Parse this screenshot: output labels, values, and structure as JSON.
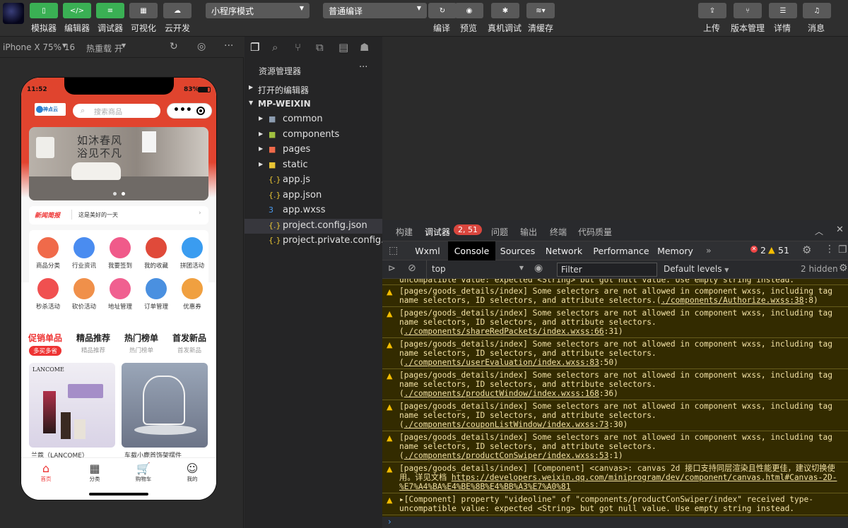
{
  "toolbar": {
    "simulator": "模拟器",
    "editor": "编辑器",
    "debugger": "调试器",
    "visual": "可视化",
    "cloud": "云开发",
    "mode_select": "小程序模式",
    "compile_select": "普通编译",
    "compile": "编译",
    "preview": "预览",
    "remote_debug": "真机调试",
    "clear_cache": "清缓存",
    "upload": "上传",
    "version": "版本管理",
    "details": "详情",
    "messages": "消息"
  },
  "sim_bar": {
    "device": "iPhone X 75% 16",
    "hot_reload": "热重载 开"
  },
  "phone": {
    "time": "11:52",
    "battery": "83%",
    "logo": "神点云",
    "search_placeholder": "搜索商品",
    "banner_line1": "如沐春风",
    "banner_line2": "浴见不凡",
    "news_tag": "新闻简报",
    "news_text": "这是美好的一天",
    "grid": [
      {
        "label": "商品分类",
        "color": "#f06a4a"
      },
      {
        "label": "行业资讯",
        "color": "#4a8cf0"
      },
      {
        "label": "我要签到",
        "color": "#f05a8a"
      },
      {
        "label": "我的收藏",
        "color": "#e04a3a"
      },
      {
        "label": "拼团活动",
        "color": "#3a9cf0"
      },
      {
        "label": "秒杀活动",
        "color": "#f05050"
      },
      {
        "label": "砍价活动",
        "color": "#f0904a"
      },
      {
        "label": "地址管理",
        "color": "#f06090"
      },
      {
        "label": "订单管理",
        "color": "#4a90e0"
      },
      {
        "label": "优惠券",
        "color": "#f0a040"
      }
    ],
    "tabs": [
      {
        "title": "促销单品",
        "sub": "多买多省"
      },
      {
        "title": "精品推荐",
        "sub": "精品推荐"
      },
      {
        "title": "热门榜单",
        "sub": "热门榜单"
      },
      {
        "title": "首发新品",
        "sub": "首发新品"
      }
    ],
    "prod1_brand": "LANCOME",
    "prod1_caption": "兰蔻（LANCOME）",
    "prod2_caption": "车载小鹿首饰架摆件",
    "nav": [
      {
        "label": "首页"
      },
      {
        "label": "分类"
      },
      {
        "label": "购物车"
      },
      {
        "label": "我的"
      }
    ]
  },
  "explorer": {
    "title": "资源管理器",
    "more": "···",
    "open_editors": "打开的编辑器",
    "project": "MP-WEIXIN",
    "items": [
      {
        "name": "common",
        "icon": "folder-icon"
      },
      {
        "name": "components",
        "icon": "folder-icon"
      },
      {
        "name": "pages",
        "icon": "folder-icon"
      },
      {
        "name": "static",
        "icon": "folder-icon"
      },
      {
        "name": "app.js",
        "icon": "js-file-icon"
      },
      {
        "name": "app.json",
        "icon": "json-file-icon"
      },
      {
        "name": "app.wxss",
        "icon": "css-file-icon"
      },
      {
        "name": "project.config.json",
        "icon": "json-file-icon"
      },
      {
        "name": "project.private.config...",
        "icon": "json-file-icon"
      }
    ]
  },
  "devtools": {
    "tabs": [
      "构建",
      "调试器",
      "问题",
      "输出",
      "终端",
      "代码质量"
    ],
    "badge": "2, 51",
    "panels": [
      "Wxml",
      "Console",
      "Sources",
      "Network",
      "Performance",
      "Memory"
    ],
    "more_panels": "»",
    "errors": "2",
    "warnings": "51",
    "context": "top",
    "filter_placeholder": "Filter",
    "levels": "Default levels",
    "hidden": "2 hidden",
    "prompt": "›",
    "messages": [
      {
        "text": "[pages/goods_details/index] Some selectors are not allowed in component wxss, including tag name selectors, ID selectors, and attribute selectors.(",
        "link": "./components/Authorize.wxss:38",
        "tail": ":8)"
      },
      {
        "text": "[pages/goods_details/index] Some selectors are not allowed in component wxss, including tag name selectors, ID selectors, and attribute selectors.(",
        "link": "./components/shareRedPackets/index.wxss:66",
        "tail": ":31)"
      },
      {
        "text": "[pages/goods_details/index] Some selectors are not allowed in component wxss, including tag name selectors, ID selectors, and attribute selectors.(",
        "link": "./components/userEvaluation/index.wxss:83",
        "tail": ":50)"
      },
      {
        "text": "[pages/goods_details/index] Some selectors are not allowed in component wxss, including tag name selectors, ID selectors, and attribute selectors.(",
        "link": "./components/productWindow/index.wxss:168",
        "tail": ":36)"
      },
      {
        "text": "[pages/goods_details/index] Some selectors are not allowed in component wxss, including tag name selectors, ID selectors, and attribute selectors.(",
        "link": "./components/couponListWindow/index.wxss:73",
        "tail": ":30)"
      },
      {
        "text": "[pages/goods_details/index] Some selectors are not allowed in component wxss, including tag name selectors, ID selectors, and attribute selectors.(",
        "link": "./components/productConSwiper/index.wxss:53",
        "tail": ":1)"
      },
      {
        "text": "[pages/goods_details/index] [Component] <canvas>: canvas 2d 接口支持同层渲染且性能更佳，建议切换使用。详见文档 ",
        "link": "https://developers.weixin.qq.com/miniprogram/dev/component/canvas.html#Canvas-2D-%E7%A4%BA%E4%BE%8B%E4%BB%A3%E7%A0%81",
        "tail": ""
      },
      {
        "text": "▸[Component] property \"videoline\" of \"components/productConSwiper/index\" received type-uncompatible value: expected <String> but got null value. Use empty string instead.",
        "link": "",
        "tail": ""
      }
    ]
  }
}
